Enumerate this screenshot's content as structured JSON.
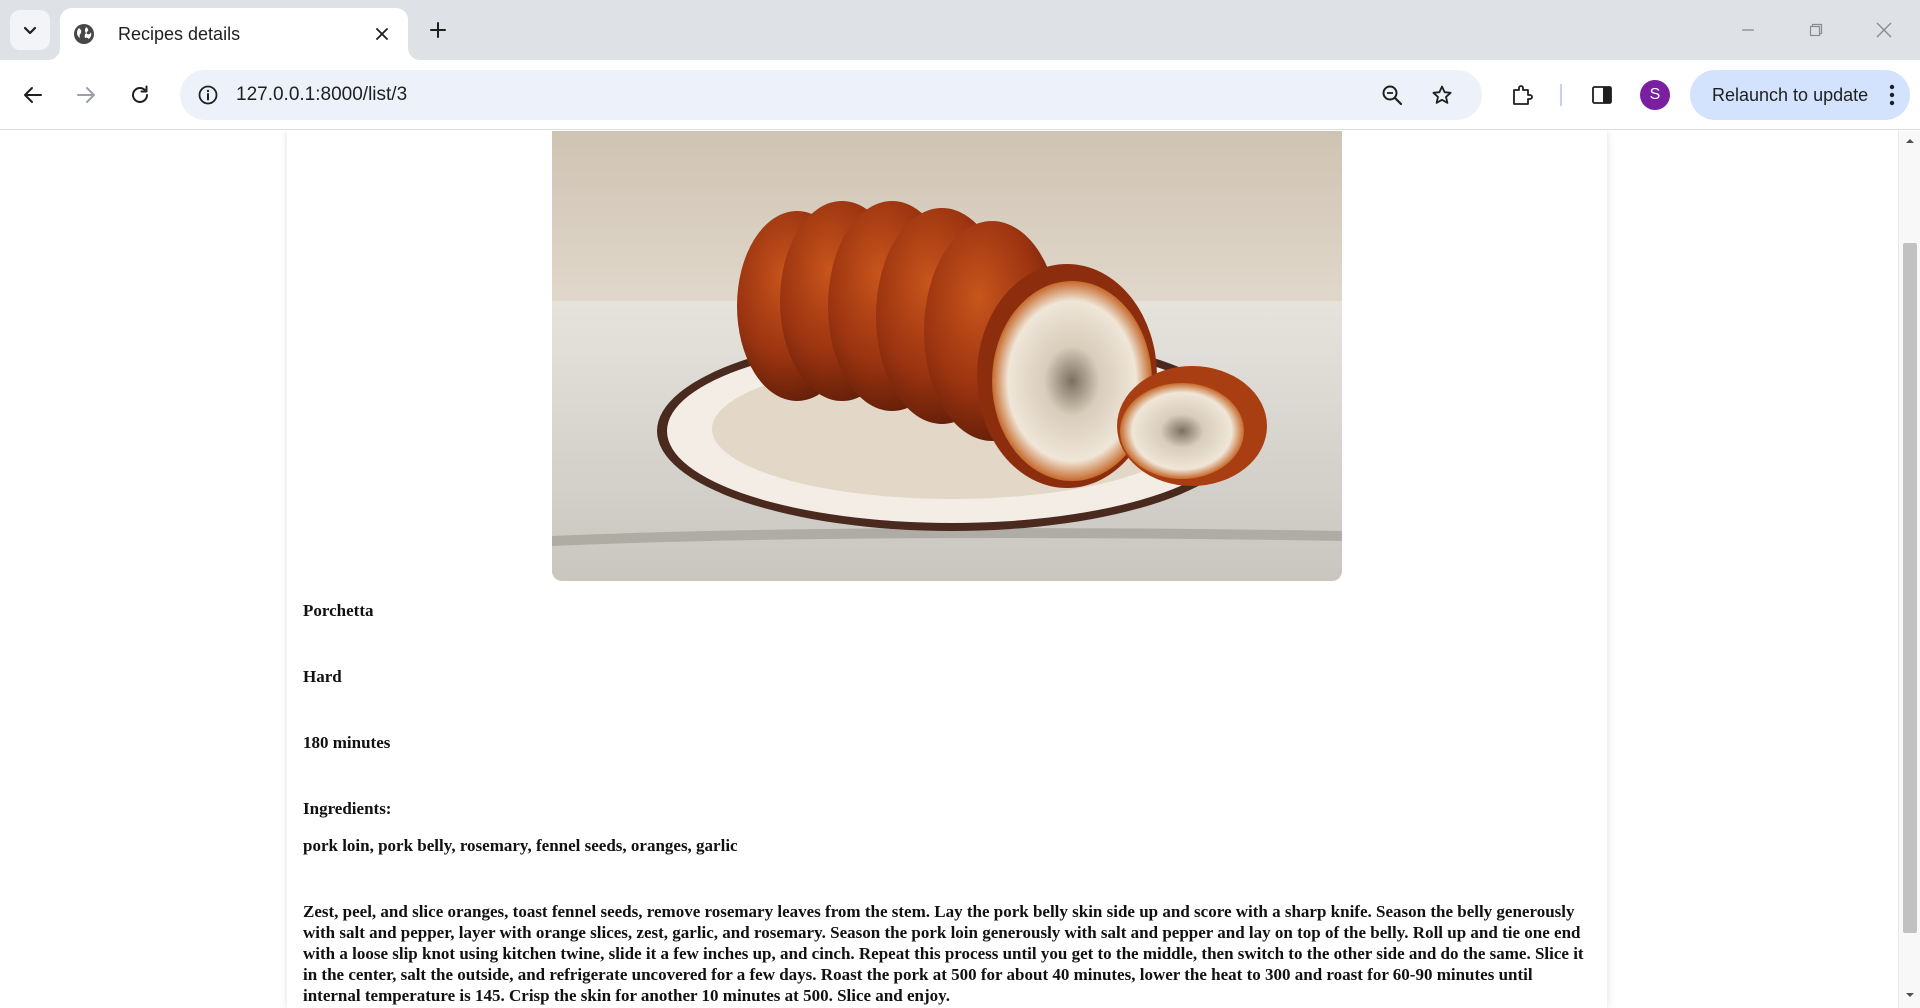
{
  "browser": {
    "tab_title": "Recipes details",
    "url": "127.0.0.1:8000/list/3",
    "profile_initial": "S",
    "relaunch_label": "Relaunch to update"
  },
  "recipe": {
    "name": "Porchetta",
    "difficulty": "Hard",
    "time": "180 minutes",
    "ingredients_label": "Ingredients:",
    "ingredients": "pork loin, pork belly, rosemary, fennel seeds, oranges, garlic",
    "instructions": "Zest, peel, and slice oranges, toast fennel seeds, remove rosemary leaves from the stem. Lay the pork belly skin side up and score with a sharp knife. Season the belly generously with salt and pepper, layer with orange slices, zest, garlic, and rosemary. Season the pork loin generously with salt and pepper and lay on top of the belly. Roll up and tie one end with a loose slip knot using kitchen twine, slide it a few inches up, and cinch. Repeat this process until you get to the middle, then switch to the other side and do the same. Slice it in the center, salt the outside, and refrigerate uncovered for a few days. Roast the pork at 500 for about 40 minutes, lower the heat to 300 and roast for 60-90 minutes until internal temperature is 145. Crisp the skin for another 10 minutes at 500. Slice and enjoy."
  },
  "colors": {
    "tabbar_bg": "#dee1e6",
    "omnibox_bg": "#edf2fa",
    "relaunch_bg": "#d3e3fd",
    "avatar_bg": "#7b1fa2"
  }
}
